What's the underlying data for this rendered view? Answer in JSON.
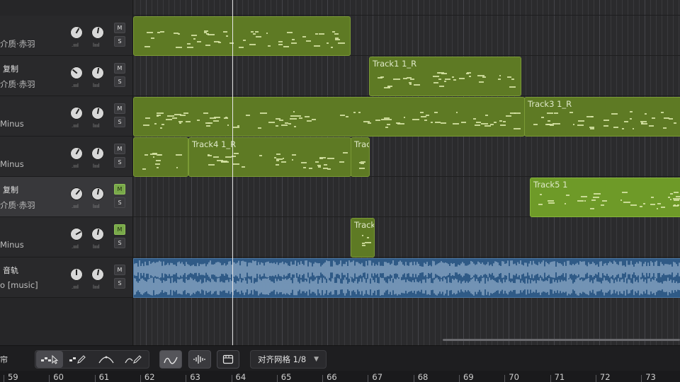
{
  "tracks": [
    {
      "name": "",
      "sub": "介质·赤羽",
      "mute": false,
      "solo": false,
      "selected": false
    },
    {
      "name": "复制",
      "sub": "介质·赤羽",
      "mute": false,
      "solo": false,
      "selected": false
    },
    {
      "name": "",
      "sub": "Minus",
      "mute": false,
      "solo": false,
      "selected": false
    },
    {
      "name": "",
      "sub": "Minus",
      "mute": false,
      "solo": false,
      "selected": false
    },
    {
      "name": "复制",
      "sub": "介质·赤羽",
      "mute": true,
      "solo": false,
      "selected": true
    },
    {
      "name": "",
      "sub": "Minus",
      "mute": true,
      "solo": false,
      "selected": false
    },
    {
      "name": "音轨",
      "sub": "o [music]",
      "mute": false,
      "solo": false,
      "selected": false
    }
  ],
  "button_labels": {
    "mute": "M",
    "solo": "S"
  },
  "clips": {
    "track1_r": "Track1 1_R",
    "track3_r": "Track3 1_R",
    "track4_r": "Track4 1_R",
    "track_cut_a": "Trac",
    "track5": "Track5 1",
    "track_cut_b": "Track"
  },
  "toolbar": {
    "panel_label": "帘",
    "tools": [
      "select-arrow-icon",
      "pencil-icon",
      "curve-arch-icon",
      "curve-pencil-icon"
    ],
    "snap_label": "对齐网格 1/8"
  },
  "ruler": {
    "bars": [
      "59",
      "60",
      "61",
      "62",
      "63",
      "64",
      "65",
      "66",
      "67",
      "68",
      "69",
      "70",
      "71",
      "72",
      "73"
    ]
  },
  "colors": {
    "midi_clip": "#5e7a24",
    "midi_clip_bright": "#6e9a28",
    "audio_clip": "#2f5a86",
    "mute_on": "#79a94a"
  }
}
